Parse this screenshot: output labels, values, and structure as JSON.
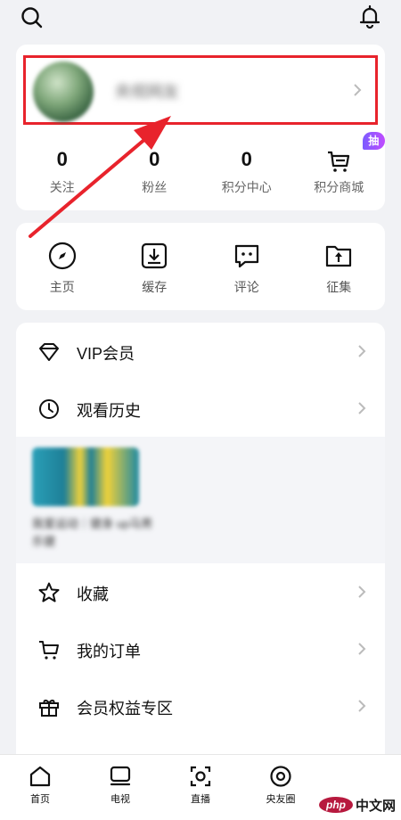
{
  "topbar": {
    "search_icon": "search-icon",
    "bell_icon": "bell-icon"
  },
  "profile": {
    "nickname": "央视网友"
  },
  "stats": [
    {
      "num": "0",
      "label": "关注"
    },
    {
      "num": "0",
      "label": "粉丝"
    },
    {
      "num": "0",
      "label": "积分中心"
    },
    {
      "num": "",
      "label": "积分商城",
      "badge": "抽奖",
      "icon": "cart-icon"
    }
  ],
  "quick": [
    {
      "label": "主页",
      "icon": "compass-icon"
    },
    {
      "label": "缓存",
      "icon": "download-icon"
    },
    {
      "label": "评论",
      "icon": "comment-icon"
    },
    {
      "label": "征集",
      "icon": "folder-upload-icon"
    }
  ],
  "list": {
    "vip": "VIP会员",
    "history": "观看历史",
    "history_item_title": "我爱运动｜健身 up马男乐健",
    "favorites": "收藏",
    "orders": "我的订单",
    "benefits": "会员权益专区"
  },
  "bottom_nav": [
    {
      "label": "首页",
      "icon": "home-icon"
    },
    {
      "label": "电视",
      "icon": "tv-icon"
    },
    {
      "label": "直播",
      "icon": "live-icon"
    },
    {
      "label": "央友圈",
      "icon": "circle-icon"
    }
  ],
  "watermark": {
    "logo": "php",
    "text": "中文网"
  },
  "colors": {
    "highlight_box": "#e8232c",
    "badge_gradient": "#7b5cff",
    "bg": "#f1f2f5"
  }
}
